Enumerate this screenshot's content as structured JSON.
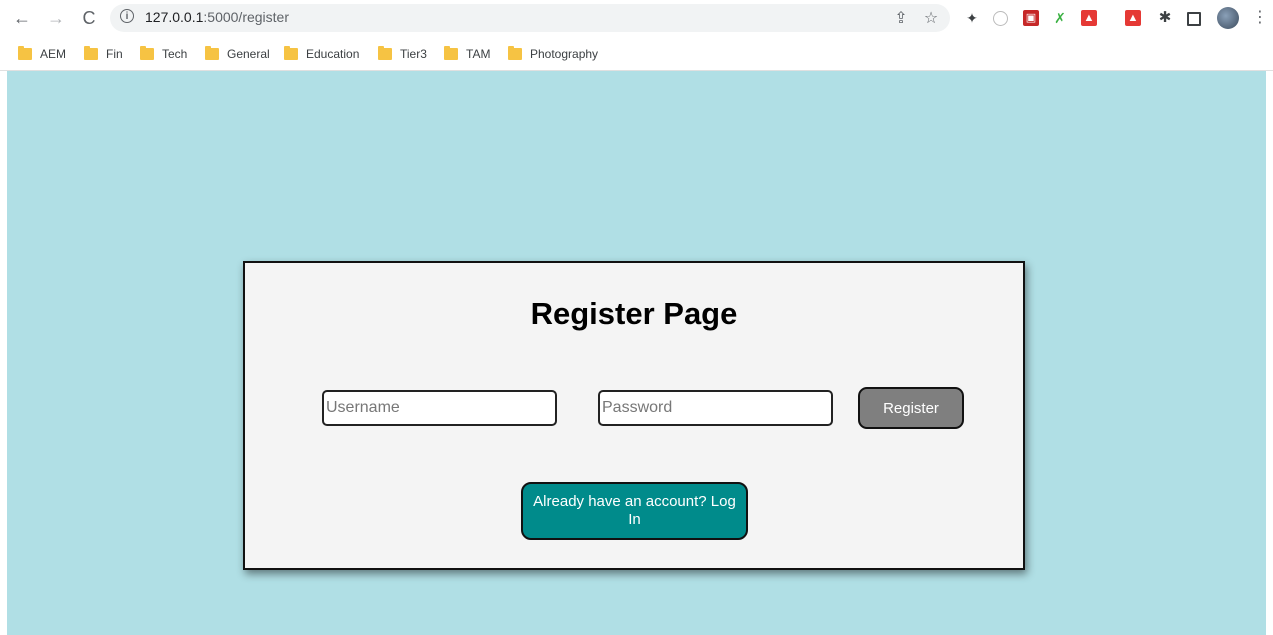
{
  "browser": {
    "url_host": "127.0.0.1",
    "url_path": ":5000/register",
    "bookmarks": [
      "AEM",
      "Fin",
      "Tech",
      "General",
      "Education",
      "Tier3",
      "TAM",
      "Photography"
    ],
    "icons": {
      "back": "arrow-left-icon",
      "forward": "arrow-right-icon",
      "reload": "reload-icon",
      "info": "info-icon",
      "share": "share-icon",
      "bookmark_star": "star-icon",
      "extensions": "puzzle-icon",
      "side_panel": "side-panel-icon",
      "menu": "kebab-menu-icon"
    }
  },
  "page": {
    "background": "#b0dfe5",
    "card_background": "#f4f4f4",
    "title": "Register Page",
    "username_placeholder": "Username",
    "password_placeholder": "Password",
    "register_label": "Register",
    "register_color": "#7f7f7f",
    "login_label": "Already have an account? Log In",
    "login_color": "#008b8b"
  }
}
